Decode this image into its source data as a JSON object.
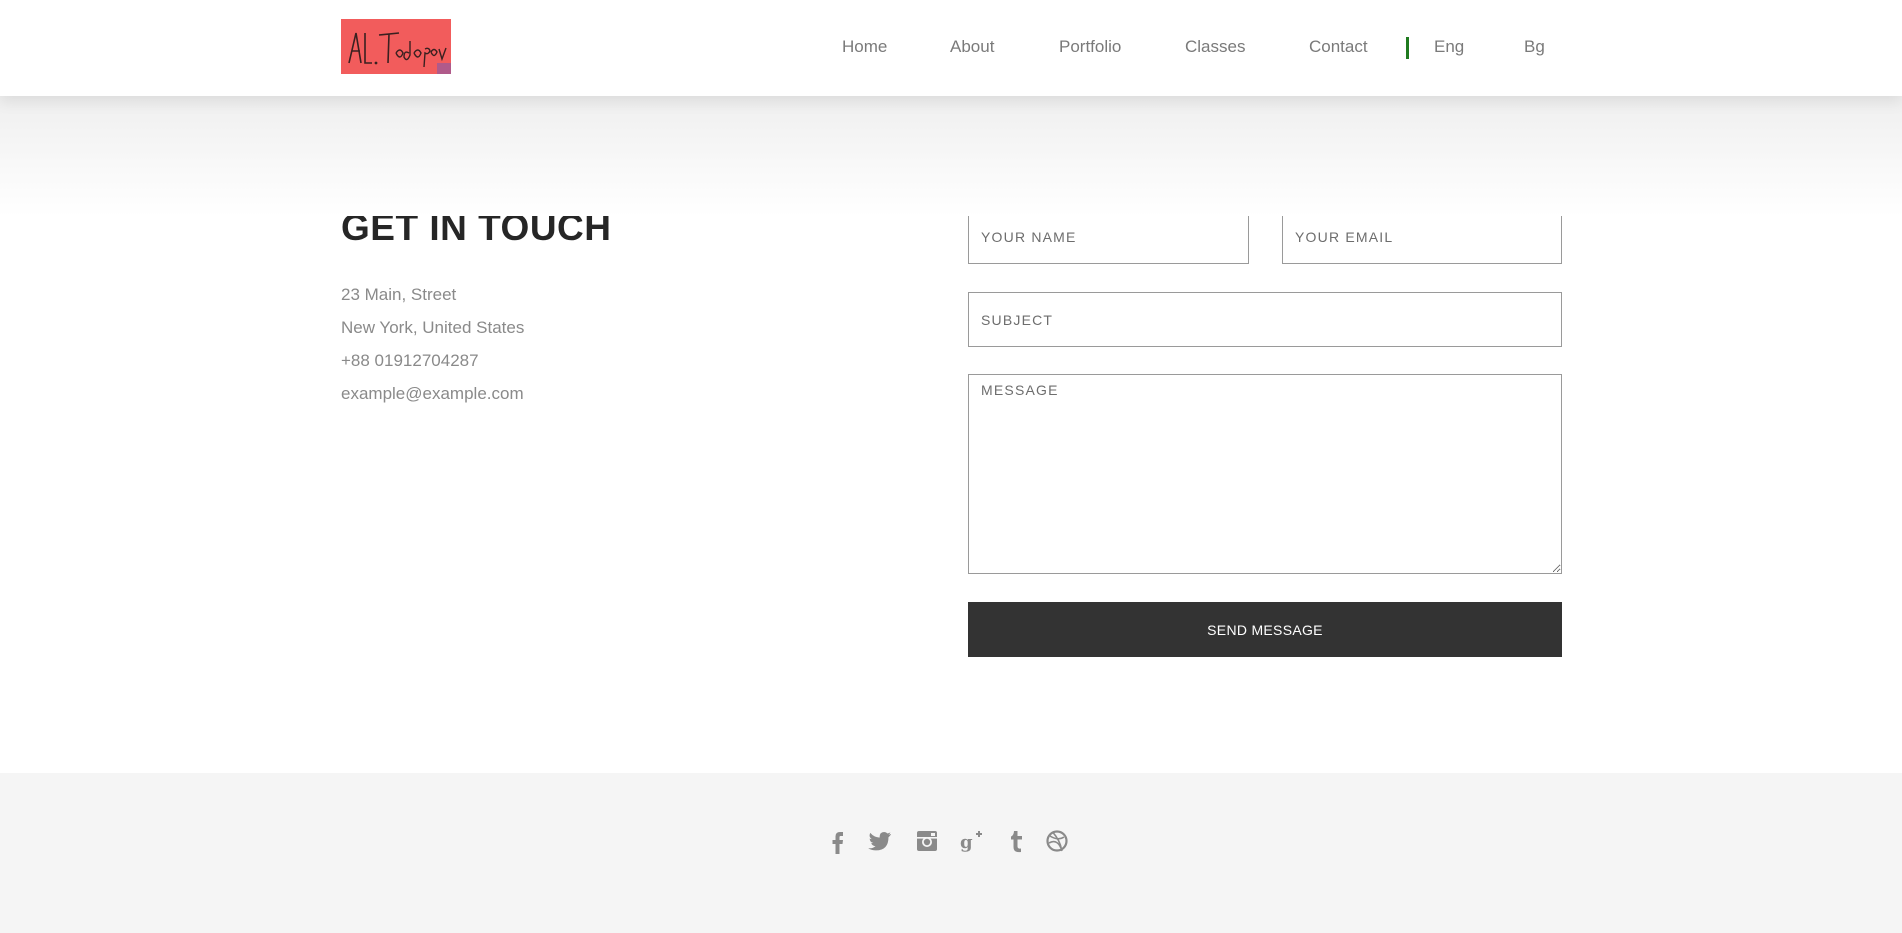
{
  "header": {
    "logo_text": "Al.Todorov",
    "nav": [
      {
        "label": "Home"
      },
      {
        "label": "About"
      },
      {
        "label": "Portfolio"
      },
      {
        "label": "Classes"
      },
      {
        "label": "Contact"
      }
    ],
    "languages": [
      {
        "label": "Eng"
      },
      {
        "label": "Bg"
      }
    ],
    "separator_color": "#1f7a1f",
    "logo_color": "#f25c5c"
  },
  "contact": {
    "title": "GET IN TOUCH",
    "address_line1": "23 Main, Street",
    "address_line2": "New York, United States",
    "phone": "+88 01912704287",
    "email": "example@example.com"
  },
  "form": {
    "name_placeholder": "YOUR NAME",
    "email_placeholder": "YOUR EMAIL",
    "subject_placeholder": "SUBJECT",
    "message_placeholder": "MESSAGE",
    "submit_label": "SEND MESSAGE",
    "button_color": "#333333"
  },
  "footer": {
    "social_icons": [
      "facebook-icon",
      "twitter-icon",
      "instagram-icon",
      "google-plus-icon",
      "tumblr-icon",
      "dribbble-icon"
    ],
    "icon_color": "#8a8a8a"
  }
}
